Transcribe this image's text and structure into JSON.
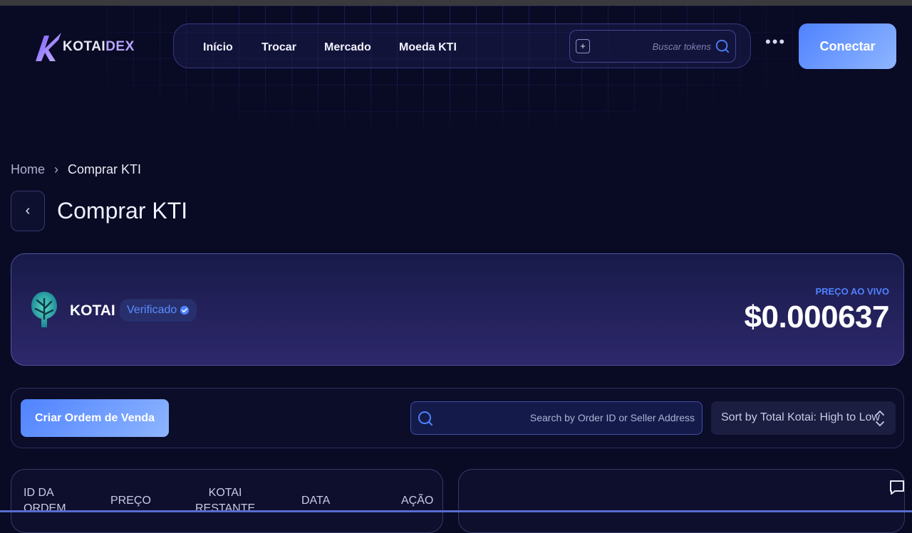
{
  "header": {
    "logo": {
      "brand": "KOTAI",
      "suffix": "DEX"
    },
    "nav": [
      "Início",
      "Trocar",
      "Mercado",
      "Moeda KTI"
    ],
    "search": {
      "placeholder": "Buscar tokens",
      "add_label": "+"
    },
    "more_label": "•••",
    "connect_label": "Conectar"
  },
  "breadcrumb": {
    "home": "Home",
    "separator": "›",
    "current": "Comprar KTI"
  },
  "page": {
    "back_label": "‹",
    "title": "Comprar KTI"
  },
  "token": {
    "name": "KOTAI",
    "badge": "Verificado",
    "live_label": "PREÇO AO VIVO",
    "price": "$0.000637"
  },
  "actions": {
    "create_sell_order": "Criar Ordem de Venda",
    "search_placeholder": "Search by Order ID or Seller Address",
    "sort_label": "Sort by Total Kotai: High to Low"
  },
  "table": {
    "columns": [
      {
        "line1": "ID DA",
        "line2": "ORDEM"
      },
      {
        "line1": "PREÇO",
        "line2": ""
      },
      {
        "line1": "KOTAI",
        "line2": "RESTANTE"
      },
      {
        "line1": "DATA",
        "line2": ""
      },
      {
        "line1": "AÇÃO",
        "line2": ""
      }
    ]
  },
  "colors": {
    "accent": "#4f82ff",
    "background": "#090a24",
    "text": "#e8eaf6"
  }
}
